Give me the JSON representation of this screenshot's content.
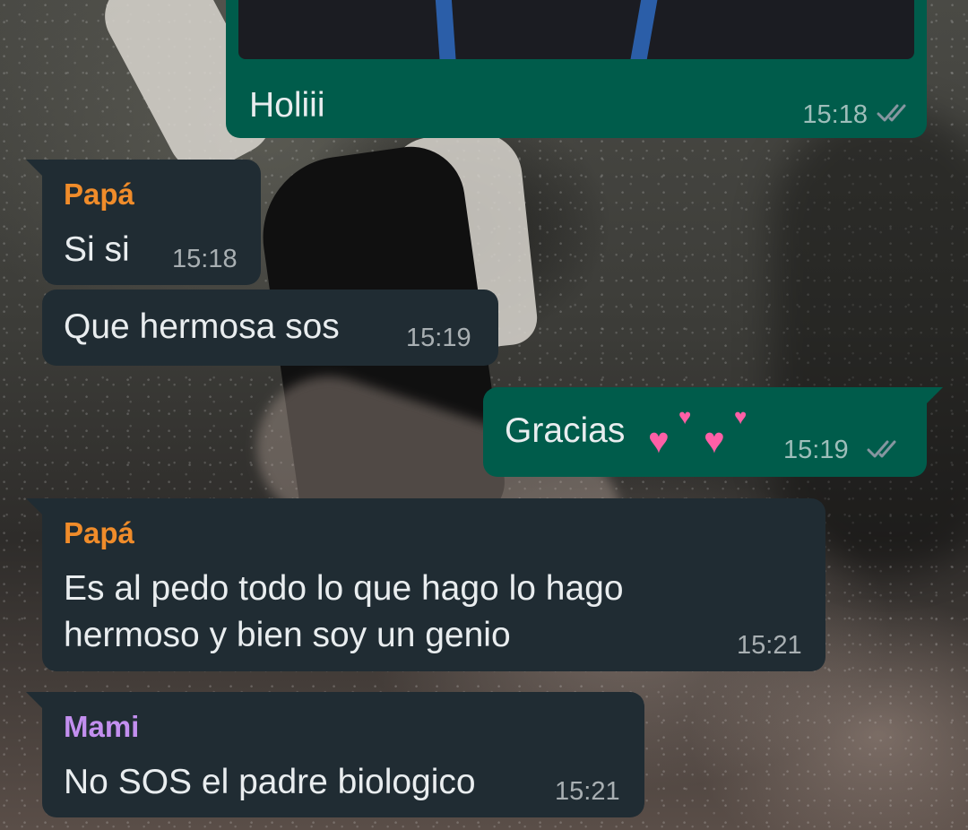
{
  "colors": {
    "incoming_bubble": "#202c33",
    "outgoing_bubble": "#005c4b",
    "papa_name": "#f08c2a",
    "mami_name": "#c38fef",
    "read_ticks": "#8696a0"
  },
  "messages": [
    {
      "direction": "outgoing",
      "has_image": true,
      "text": "Holiii",
      "time": "15:18",
      "status": "read-ticks-icon"
    },
    {
      "direction": "incoming",
      "sender": "Papá",
      "text": "Si si",
      "time": "15:18"
    },
    {
      "direction": "incoming",
      "text": "Que hermosa sos",
      "time": "15:19"
    },
    {
      "direction": "outgoing",
      "text": "Gracias",
      "emoji": "two-hearts-icon",
      "time": "15:19",
      "status": "read-ticks-icon"
    },
    {
      "direction": "incoming",
      "sender": "Papá",
      "lines": [
        "Es al pedo todo lo que hago lo hago",
        "hermoso y bien soy un genio"
      ],
      "time": "15:21"
    },
    {
      "direction": "incoming",
      "sender": "Mami",
      "text": "No SOS el padre biologico",
      "time": "15:21"
    }
  ]
}
